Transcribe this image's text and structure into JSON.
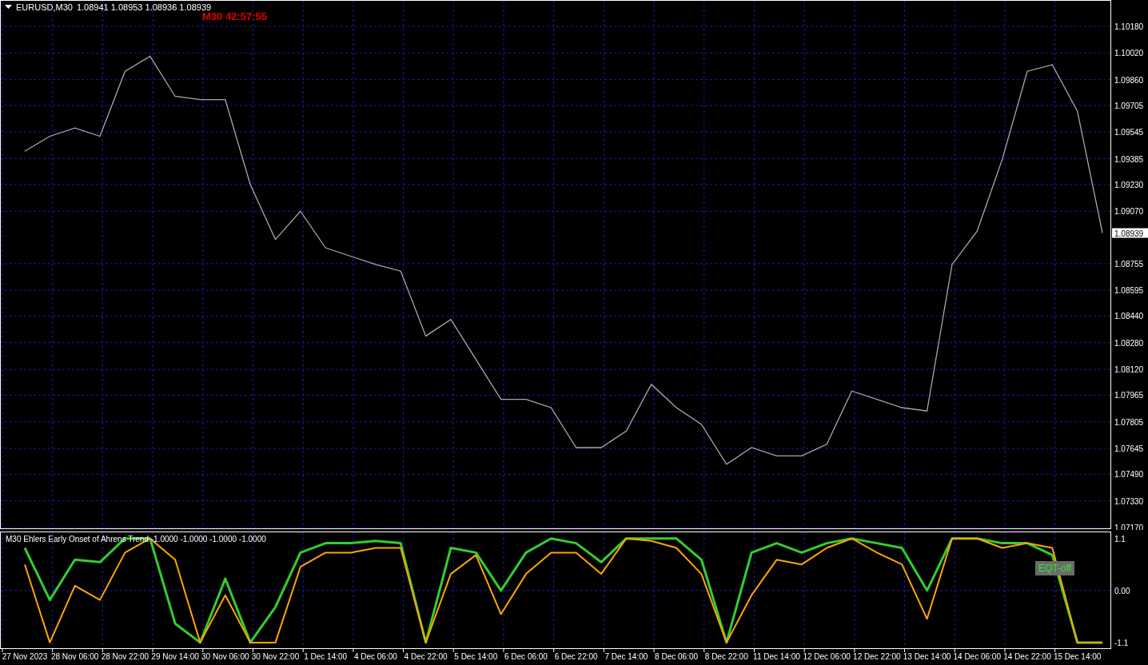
{
  "chart_header": {
    "symbol": "EURUSD,M30",
    "ohlc": "1.08941 1.08953 1.08936 1.08939"
  },
  "timer": "M30 42:57:55",
  "price_chart": {
    "current_price": "1.08939",
    "chart_data": {
      "type": "line",
      "grid": true,
      "series": [
        {
          "color": "#a8a8a8",
          "values": [
            1.0943,
            1.0952,
            1.0957,
            1.0952,
            1.0991,
            1.1,
            1.0976,
            1.0974,
            1.0974,
            1.0923,
            1.089,
            1.0907,
            1.0885,
            1.088,
            1.0875,
            1.0871,
            1.0832,
            1.0842,
            1.0818,
            1.0794,
            1.0794,
            1.0789,
            1.0765,
            1.0765,
            1.0775,
            1.0803,
            1.0789,
            1.0779,
            1.0755,
            1.0765,
            1.076,
            1.076,
            1.0767,
            1.0799,
            1.0794,
            1.0789,
            1.0787,
            1.0875,
            1.0895,
            1.0938,
            1.0991,
            1.0995,
            1.0967,
            1.08939
          ]
        }
      ],
      "ylim": [
        1.0717,
        1.1018
      ],
      "yticks": [
        {
          "value": 1.1018,
          "label": "1.10180"
        },
        {
          "value": 1.1002,
          "label": "1.10020"
        },
        {
          "value": 1.0986,
          "label": "1.09860"
        },
        {
          "value": 1.09705,
          "label": "1.09705"
        },
        {
          "value": 1.09545,
          "label": "1.09545"
        },
        {
          "value": 1.09385,
          "label": "1.09385"
        },
        {
          "value": 1.0923,
          "label": "1.09230"
        },
        {
          "value": 1.0907,
          "label": "1.09070"
        },
        {
          "value": 1.08755,
          "label": "1.08755"
        },
        {
          "value": 1.08595,
          "label": "1.08595"
        },
        {
          "value": 1.0844,
          "label": "1.08440"
        },
        {
          "value": 1.0828,
          "label": "1.08280"
        },
        {
          "value": 1.0812,
          "label": "1.08120"
        },
        {
          "value": 1.07965,
          "label": "1.07965"
        },
        {
          "value": 1.07805,
          "label": "1.07805"
        },
        {
          "value": 1.07645,
          "label": "1.07645"
        },
        {
          "value": 1.0749,
          "label": "1.07490"
        },
        {
          "value": 1.0733,
          "label": "1.07330"
        },
        {
          "value": 1.0717,
          "label": "1.07170"
        }
      ]
    }
  },
  "indicator": {
    "title": "M30 Ehlers Early Onset of Ahrens Trend -1.0000 -1.0000 -1.0000 -1.0000",
    "button": "EQT-off",
    "chart_data": {
      "type": "line",
      "grid": true,
      "categories": [
        "27 Nov 2023",
        null,
        "28 Nov 06:00",
        null,
        "28 Nov 22:00",
        null,
        "29 Nov 14:00",
        null,
        "30 Nov 06:00",
        null,
        "30 Nov 22:00",
        null,
        "1 Dec 14:00",
        null,
        "4 Dec 06:00",
        null,
        "4 Dec 22:00",
        null,
        "5 Dec 14:00",
        null,
        "6 Dec 06:00",
        null,
        "6 Dec 22:00",
        null,
        "7 Dec 14:00",
        null,
        "8 Dec 06:00",
        null,
        "8 Dec 22:00",
        null,
        "11 Dec 14:00",
        null,
        "12 Dec 06:00",
        null,
        "12 Dec 22:00",
        null,
        "13 Dec 14:00",
        null,
        "14 Dec 06:00",
        null,
        "14 Dec 22:00",
        null,
        "15 Dec 14:00",
        null
      ],
      "series": [
        {
          "color": "#32cd32",
          "values": [
            0.9,
            -0.2,
            0.65,
            0.6,
            1.1,
            1.1,
            -0.7,
            -1.1,
            0.25,
            -1.1,
            -0.35,
            0.8,
            1.0,
            1.0,
            1.05,
            1.0,
            -1.1,
            0.9,
            0.8,
            0,
            0.8,
            1.1,
            1.0,
            0.6,
            1.1,
            1.1,
            1.1,
            0.65,
            -1.1,
            0.8,
            1.0,
            0.8,
            1.0,
            1.1,
            1.0,
            0.9,
            0,
            1.1,
            1.1,
            1.0,
            1.0,
            0.75,
            -1.1,
            -1.1
          ]
        },
        {
          "color": "#ffa500",
          "values": [
            0.55,
            -1.1,
            0.1,
            -0.2,
            0.8,
            1.1,
            0.65,
            -1.1,
            -0.1,
            -1.1,
            -1.1,
            0.5,
            0.8,
            0.8,
            0.9,
            0.9,
            -1.1,
            0.35,
            0.75,
            -0.5,
            0.35,
            0.8,
            0.8,
            0.35,
            1.1,
            1.05,
            0.9,
            0.35,
            -1.1,
            -0.1,
            0.65,
            0.55,
            0.9,
            1.1,
            0.8,
            0.55,
            -0.6,
            1.1,
            1.1,
            0.9,
            1.0,
            0.9,
            -1.1,
            -1.1
          ]
        }
      ],
      "ylim": [
        -1.22,
        1.23
      ],
      "yticks": [
        {
          "value": 1.1,
          "label": "1.1"
        },
        {
          "value": 0,
          "label": "0.00"
        },
        {
          "value": -1.1,
          "label": "-1.1"
        }
      ]
    }
  }
}
